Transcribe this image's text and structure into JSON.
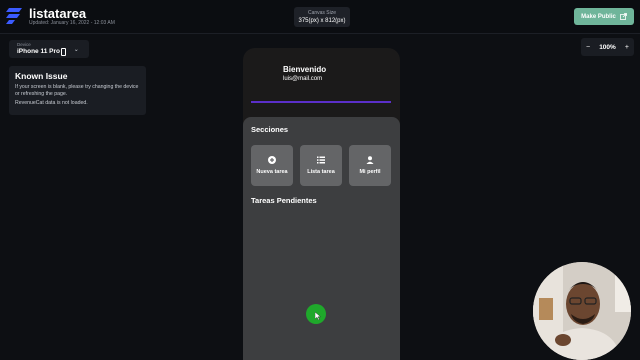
{
  "header": {
    "app_title": "listatarea",
    "updated": "Updated: January 16, 2022 - 12:03 AM",
    "canvas_size_label": "Canvas Size",
    "canvas_size_value": "375(px) x 812(px)",
    "make_public_label": "Make Public"
  },
  "device": {
    "label": "Device",
    "value": "iPhone 11 Pro"
  },
  "known_issue": {
    "title": "Known Issue",
    "body": "If your screen is blank, please try changing the device or refreshing the page.",
    "note": "RevenueCat data is not loaded."
  },
  "zoom": {
    "minus": "−",
    "value": "100%",
    "plus": "+"
  },
  "phone": {
    "welcome": "Bienvenido",
    "email": "luis@mail.com",
    "sections_title": "Secciones",
    "tiles": [
      {
        "label": "Nueva tarea",
        "icon": "plus-circle-icon"
      },
      {
        "label": "Lista tarea",
        "icon": "list-icon"
      },
      {
        "label": "Mi perfil",
        "icon": "person-icon"
      }
    ],
    "pending_title": "Tareas Pendientes"
  },
  "colors": {
    "accent_green": "#6fb59a",
    "divider_purple": "#5b2fc9",
    "fab_green": "#1fa82b"
  }
}
